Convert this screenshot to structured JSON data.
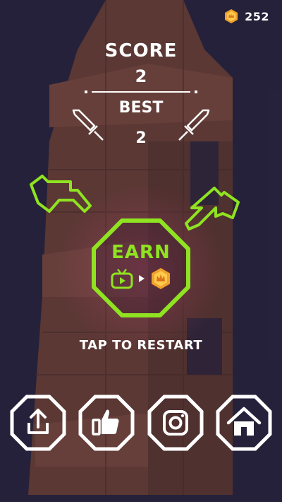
{
  "hud": {
    "coins": "252"
  },
  "score": {
    "label": "SCORE",
    "value": "2"
  },
  "best": {
    "label": "BEST",
    "value": "2"
  },
  "earn": {
    "label": "EARN"
  },
  "restart": {
    "label": "TAP TO RESTART"
  },
  "colors": {
    "accent": "#8fe321",
    "coin": "#f1a22b",
    "white": "#ffffff"
  },
  "buttons": [
    {
      "icon": "share-icon"
    },
    {
      "icon": "thumbs-up-icon"
    },
    {
      "icon": "instagram-icon"
    },
    {
      "icon": "home-icon"
    }
  ]
}
